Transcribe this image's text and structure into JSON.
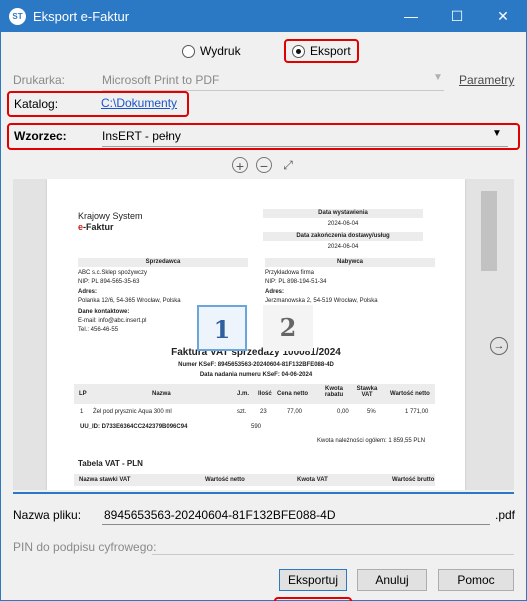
{
  "window": {
    "title": "Eksport e-Faktur",
    "icon_text": "ST",
    "minimize": "—",
    "maximize": "☐",
    "close": "✕"
  },
  "mode": {
    "options": [
      "Wydruk",
      "Eksport"
    ],
    "selected": "Eksport"
  },
  "printer": {
    "label": "Drukarka:",
    "value": "Microsoft Print to PDF",
    "params_link": "Parametry"
  },
  "catalog": {
    "label": "Katalog:",
    "value": "C:\\Dokumenty"
  },
  "template": {
    "label": "Wzorzec:",
    "value": "InsERT - pełny"
  },
  "preview": {
    "brand_line1": "Krajowy System",
    "brand_line2_accent": "e",
    "brand_line2_rest": "-Faktur",
    "issue_date_label": "Data wystawienia",
    "issue_date": "2024-06-04",
    "delivery_date_label": "Data zakończenia dostawy/usług",
    "delivery_date": "2024-06-04",
    "seller_label": "Sprzedawca",
    "seller_name": "ABC s.c.Sklep spożywczy",
    "seller_nip": "NIP: PL 894-565-35-63",
    "seller_address_label": "Adres:",
    "seller_address": "Polanka 12/6, 54-365 Wrocław, Polska",
    "contact_label": "Dane kontaktowe:",
    "contact_email": "E-mail: info@abc.insert.pl",
    "contact_phone": "Tel.: 456-46-55",
    "buyer_label": "Nabywca",
    "buyer_name": "Przykładowa firma",
    "buyer_nip": "NIP: PL 898-194-51-34",
    "buyer_address_label": "Adres:",
    "buyer_address": "Jerzmanowska 2, 54-519 Wrocław, Polska",
    "invoice_title": "Faktura VAT sprzedaży 100081/2024",
    "ksef_number": "Numer KSeF: 8945653563-20240604-81F132BFE088-4D",
    "ksef_date": "Data nadania numeru KSeF: 04-06-2024",
    "table_headers": [
      "LP",
      "Nazwa",
      "J.m.",
      "Ilość",
      "Cena netto",
      "Kwota rabatu",
      "Stawka VAT",
      "Wartość netto"
    ],
    "table_row": [
      "1",
      "Żel pod prysznic Aqua 300 ml",
      "szt.",
      "23",
      "77,00",
      "0,00",
      "5%",
      "1 771,00"
    ],
    "uu_id": "UU_ID: D733E6364CC242379B096C94",
    "uu_id_suffix": "590",
    "total_label": "Kwota należności ogółem: 1 859,55 PLN",
    "vat_table_title": "Tabela VAT - PLN",
    "vat_headers": [
      "Nazwa stawki VAT",
      "Wartość netto",
      "Kwota VAT",
      "Wartość brutto"
    ]
  },
  "pages": [
    "1",
    "2"
  ],
  "filename": {
    "label": "Nazwa pliku:",
    "value": "8945653563-20240604-81F132BFE088-4D",
    "extension": ".pdf"
  },
  "pin": {
    "label": "PIN do podpisu cyfrowego:"
  },
  "buttons": {
    "export": "Eksportuj",
    "cancel": "Anuluj",
    "help": "Pomoc"
  },
  "colors": {
    "accent": "#2b78c5",
    "highlight": "#e00000",
    "brand_red": "#d0201a"
  }
}
